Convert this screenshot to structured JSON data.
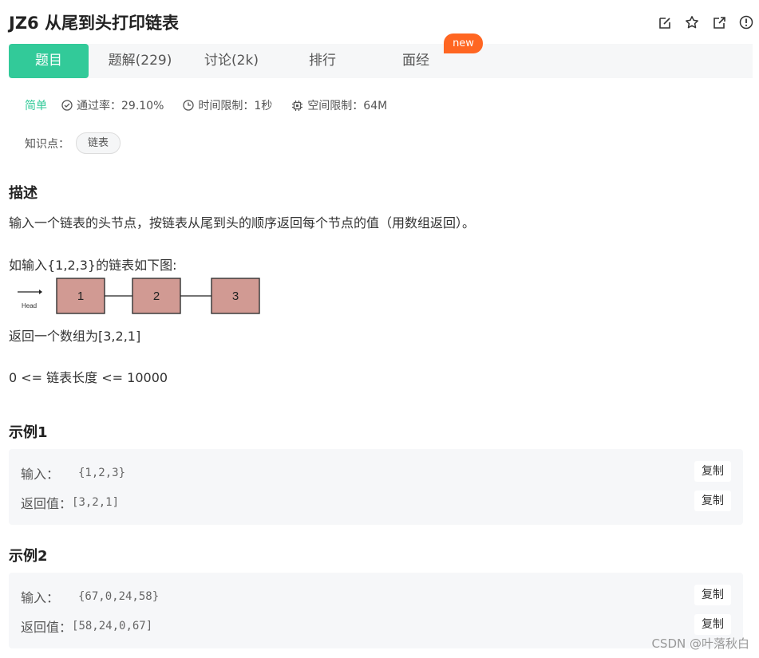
{
  "title": "JZ6  从尾到头打印链表",
  "tabs": [
    {
      "label": "题目"
    },
    {
      "label": "题解(229)"
    },
    {
      "label": "讨论(2k)"
    },
    {
      "label": "排行"
    },
    {
      "label": "面经"
    }
  ],
  "new_badge": "new",
  "meta": {
    "difficulty": "简单",
    "pass_rate": "通过率：29.10%",
    "time_limit": "时间限制：1秒",
    "space_limit": "空间限制：64M"
  },
  "knowledge": {
    "label": "知识点：",
    "tag": "链表"
  },
  "description": {
    "heading": "描述",
    "text": "输入一个链表的头节点，按链表从尾到头的顺序返回每个节点的值（用数组返回）。",
    "example_intro": "如输入{1,2,3}的链表如下图:",
    "diagram": {
      "head_label": "Head",
      "nodes": [
        "1",
        "2",
        "3"
      ]
    },
    "return_text": "返回一个数组为[3,2,1]",
    "constraint": "0 <= 链表长度 <= 10000"
  },
  "examples": [
    {
      "heading": "示例1",
      "input_label": "输入：",
      "input": "{1,2,3}",
      "output_label": "返回值：",
      "output": "[3,2,1]",
      "copy_label": "复制"
    },
    {
      "heading": "示例2",
      "input_label": "输入：",
      "input": "{67,0,24,58}",
      "output_label": "返回值：",
      "output": "[58,24,0,67]",
      "copy_label": "复制"
    }
  ],
  "watermark": "CSDN @叶落秋白",
  "colors": {
    "accent": "#32ca99",
    "badge": "#ff6622",
    "node_fill": "#d19a93"
  }
}
